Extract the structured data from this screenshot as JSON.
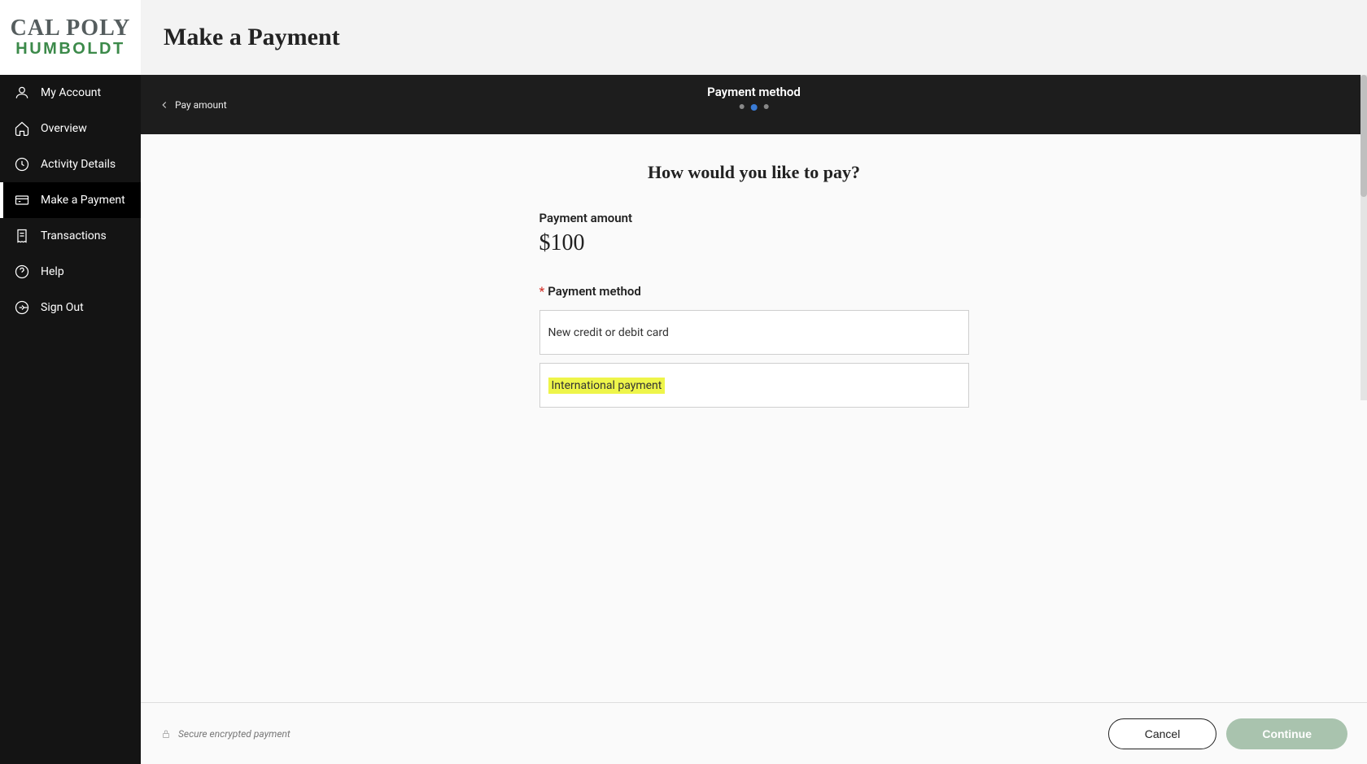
{
  "logo": {
    "line1": "CAL POLY",
    "line2": "HUMBOLDT"
  },
  "header": {
    "page_title": "Make a Payment"
  },
  "sidebar": {
    "items": [
      {
        "label": "My Account"
      },
      {
        "label": "Overview"
      },
      {
        "label": "Activity Details"
      },
      {
        "label": "Make a Payment"
      },
      {
        "label": "Transactions"
      },
      {
        "label": "Help"
      },
      {
        "label": "Sign Out"
      }
    ]
  },
  "stepper": {
    "back_label": "Pay amount",
    "title": "Payment method",
    "current_step": 2,
    "total_steps": 3
  },
  "content": {
    "question": "How would you like to pay?",
    "amount_label": "Payment amount",
    "amount_value": "$100",
    "method_label": "Payment method",
    "options": [
      {
        "label": "New credit or debit card",
        "highlighted": false
      },
      {
        "label": "International payment",
        "highlighted": true
      }
    ]
  },
  "footer": {
    "secure_text": "Secure encrypted payment",
    "cancel_label": "Cancel",
    "continue_label": "Continue"
  }
}
